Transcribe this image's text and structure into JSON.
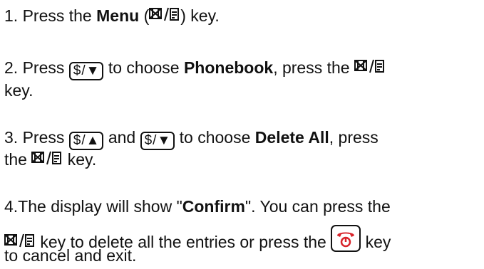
{
  "steps": {
    "s1": {
      "a": "1. Press the ",
      "b": "Menu",
      "c": " (",
      "d": ") key."
    },
    "s2": {
      "a": "2. Press ",
      "b": " to choose ",
      "c": "Phonebook",
      "d": ", press the ",
      "e": "key."
    },
    "s3": {
      "a": "3. Press ",
      "b": " and ",
      "c": " to choose ",
      "d": "Delete All",
      "e": ", press",
      "f": "the ",
      "g": " key."
    },
    "s4": {
      "a": "4.The display will show \"",
      "b": "Confirm",
      "c": "\". You can press the",
      "d": " key to delete all the entries or press the ",
      "e": " key",
      "f": "to cancel and exit."
    }
  },
  "keys": {
    "scroll_symbol": "$",
    "slash": "/",
    "down_arrow": "▼",
    "up_arrow": "▲"
  }
}
